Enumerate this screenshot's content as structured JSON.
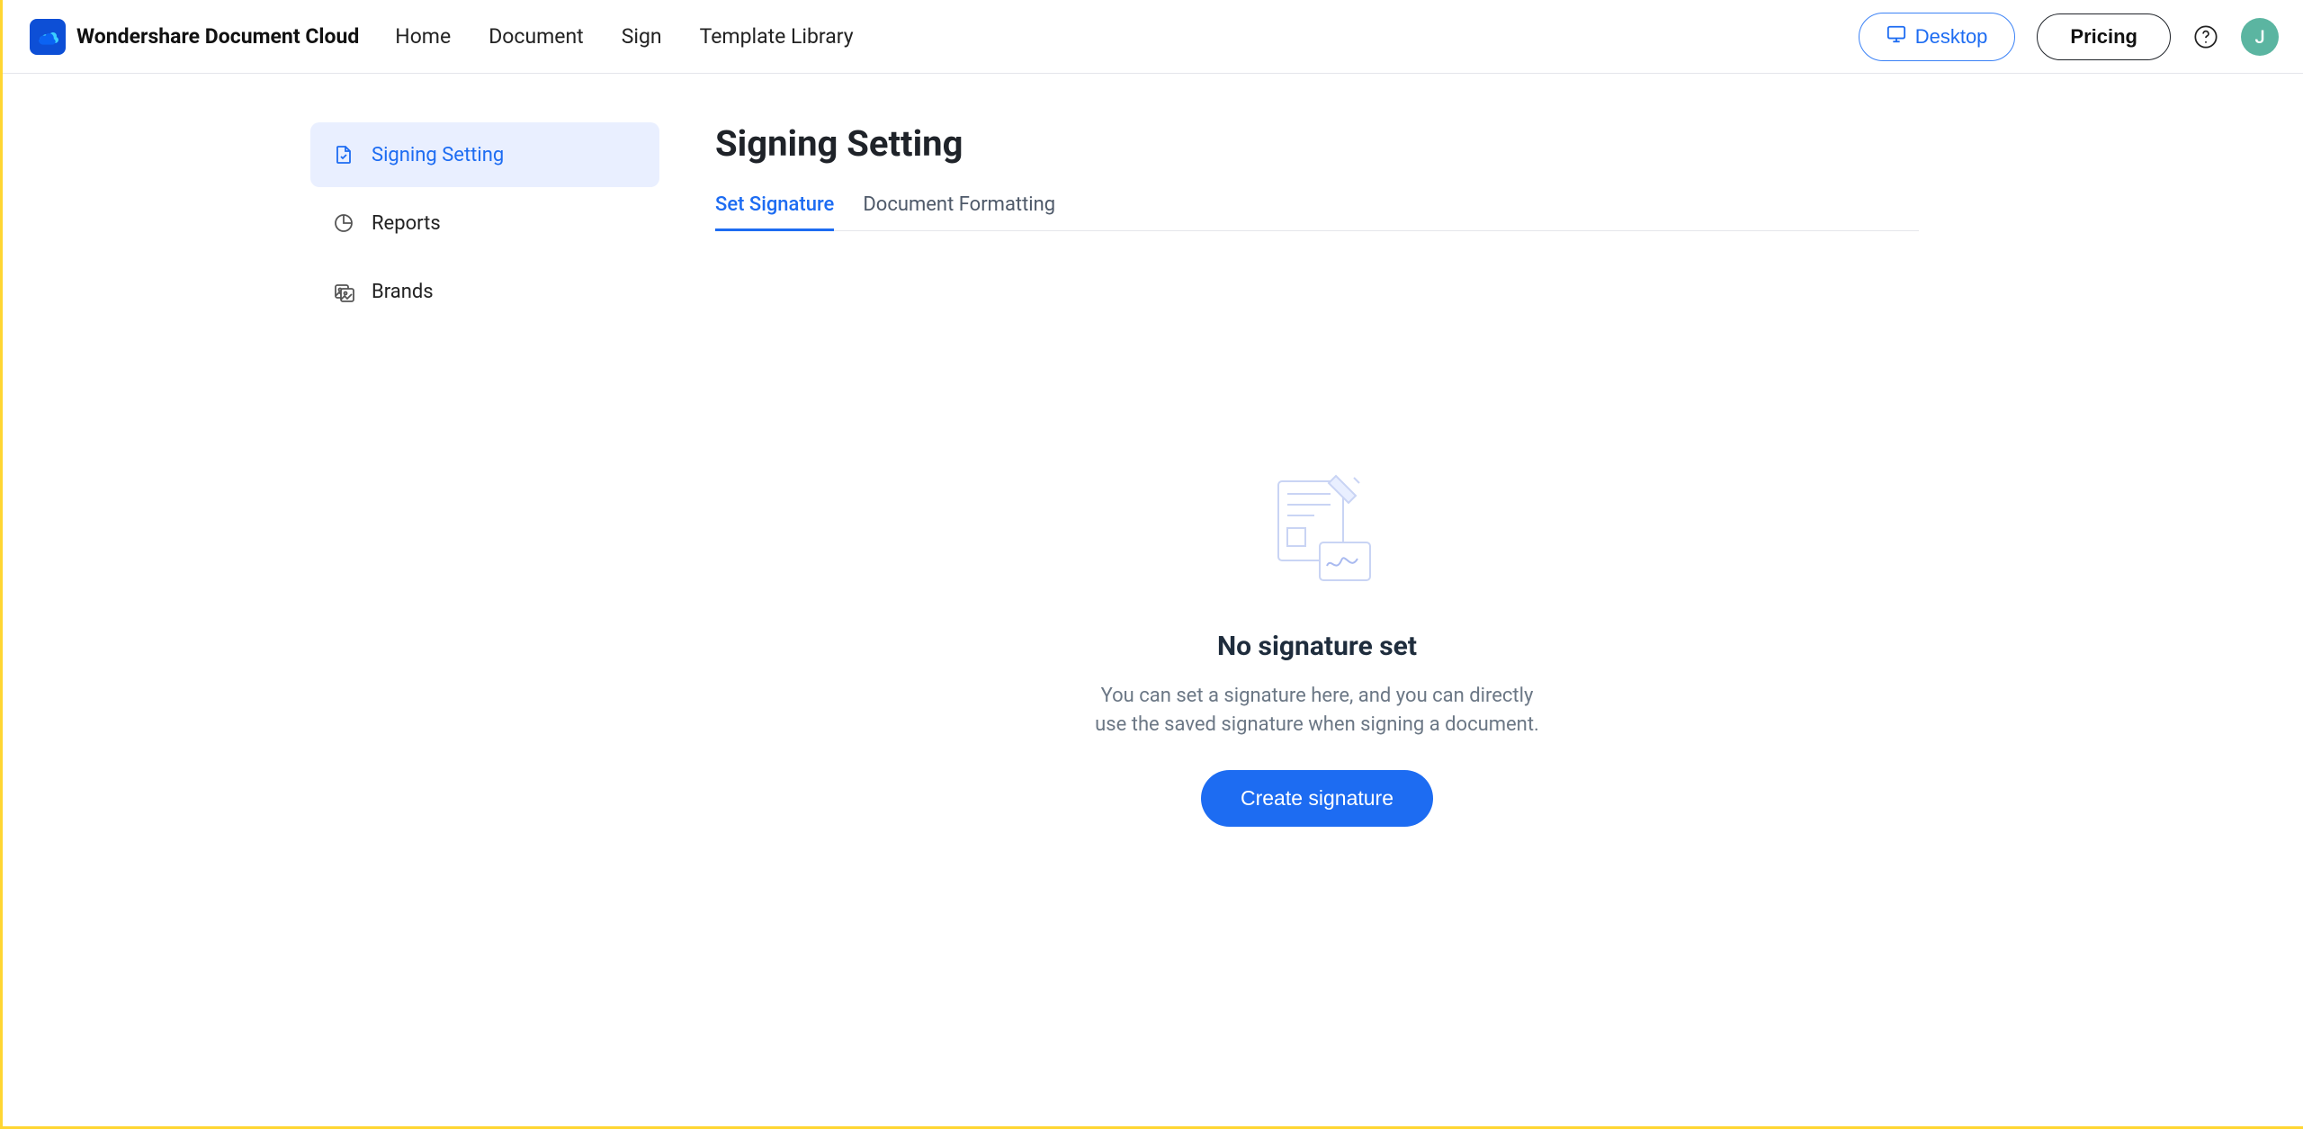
{
  "brand": {
    "name": "Wondershare Document Cloud"
  },
  "nav": {
    "home": "Home",
    "document": "Document",
    "sign": "Sign",
    "template_library": "Template Library"
  },
  "header_actions": {
    "desktop": "Desktop",
    "pricing": "Pricing",
    "avatar_initial": "J"
  },
  "sidebar": {
    "signing_setting": "Signing Setting",
    "reports": "Reports",
    "brands": "Brands"
  },
  "page": {
    "title": "Signing Setting",
    "tabs": {
      "set_signature": "Set Signature",
      "document_formatting": "Document Formatting"
    },
    "empty": {
      "title": "No signature set",
      "desc": "You can set a signature here, and you can directly use the saved signature when signing a document.",
      "cta": "Create signature"
    }
  }
}
